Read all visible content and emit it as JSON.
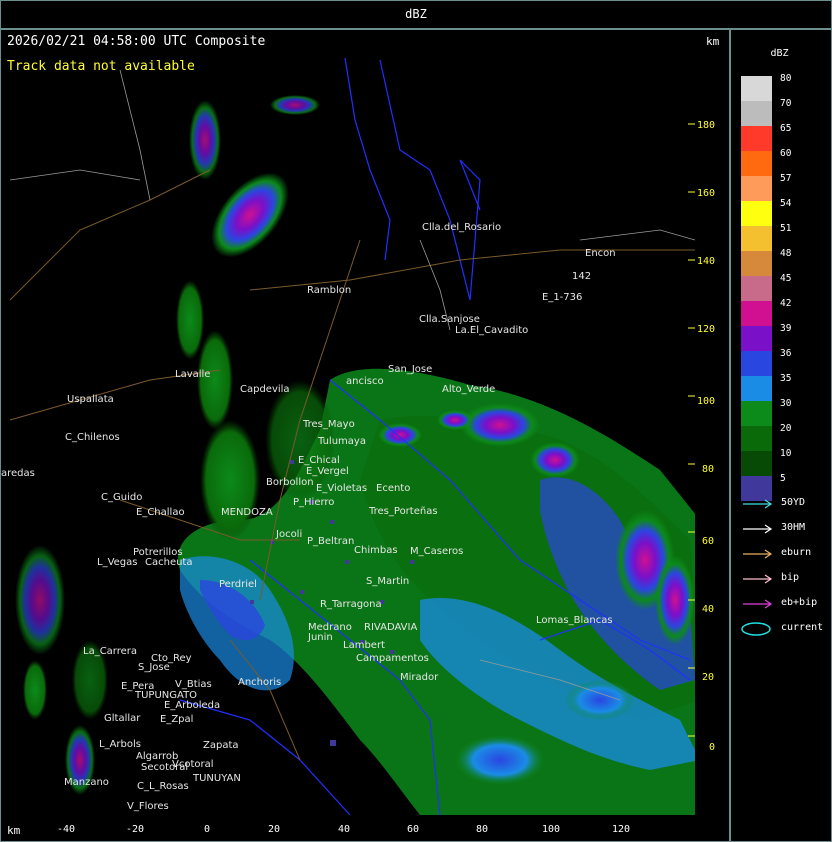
{
  "title": "dBZ",
  "header": "2026/02/21 04:58:00 UTC Composite",
  "track_message": "Track data not available",
  "km_top": "km",
  "km_bottom": "km",
  "y_ticks": [
    "180",
    "160",
    "140",
    "120",
    "100",
    "80",
    "60",
    "40",
    "20",
    "0"
  ],
  "x_ticks": [
    "-40",
    "-20",
    "0",
    "20",
    "40",
    "60",
    "80",
    "100",
    "120"
  ],
  "legend": {
    "title": "dBZ",
    "levels": [
      {
        "label": "80",
        "color": "#d8d8d8"
      },
      {
        "label": "70",
        "color": "#bcbcbc"
      },
      {
        "label": "65",
        "color": "#ff3a2a"
      },
      {
        "label": "60",
        "color": "#ff6a10"
      },
      {
        "label": "57",
        "color": "#ff9b5a"
      },
      {
        "label": "54",
        "color": "#ffff10"
      },
      {
        "label": "51",
        "color": "#f5c030"
      },
      {
        "label": "48",
        "color": "#d6893a"
      },
      {
        "label": "45",
        "color": "#c86a8a"
      },
      {
        "label": "42",
        "color": "#d01090"
      },
      {
        "label": "39",
        "color": "#7a10c8"
      },
      {
        "label": "36",
        "color": "#2a46e0"
      },
      {
        "label": "35",
        "color": "#1a8ce6"
      },
      {
        "label": "30",
        "color": "#0c8a1a"
      },
      {
        "label": "20",
        "color": "#0a6a0a"
      },
      {
        "label": "10",
        "color": "#064a06"
      },
      {
        "label": "5",
        "color": "#40389a"
      }
    ],
    "tracks": [
      {
        "label": "50YD",
        "color": "#40e0e0"
      },
      {
        "label": "30HM",
        "color": "#ffffff"
      },
      {
        "label": "eburn",
        "color": "#e8b060"
      },
      {
        "label": "bip",
        "color": "#ffc0d0"
      },
      {
        "label": "eb+bip",
        "color": "#e040e0"
      },
      {
        "label": "current",
        "color": "#20e0e0"
      }
    ]
  },
  "places": [
    "Clla.del_Rosario",
    "Encon",
    "142",
    "E_1-736",
    "Ramblon",
    "Clla.Sanjose",
    "La.El_Cavadito",
    "Uspallata",
    "C_Chilenos",
    "aredas",
    "San_Jose",
    "ancisco",
    "Tres_Mayo",
    "Tulumaya",
    "E_Chical",
    "E_Vergel",
    "Borbollon",
    "E_Violetas",
    "Ecento",
    "P_Hierro",
    "C_Guido",
    "E_Challao",
    "MENDOZA",
    "P_Beltran",
    "Chimbas",
    "M_Caseros",
    "Potrerillos",
    "Cacheuta",
    "L_Vegas",
    "Perdriel",
    "R_Tarragona",
    "Junin",
    "RIVADAVIA",
    "La_Carrera",
    "Cto_Rey",
    "S_Jose",
    "E_Pera",
    "TUPUNGATO",
    "V_Btias",
    "Anchoris",
    "E_Arboleda",
    "Gltallar",
    "E_Zpal",
    "L_Arbols",
    "Algarrob",
    "Zapata",
    "Vcotoral",
    "Secotoral",
    "TUNUYAN",
    "C_L_Rosas",
    "Manzano",
    "V_Flores",
    "Mirador",
    "Campamentos",
    "S_Martin",
    "Lomas_Blancas",
    "Tres_Porteñas",
    "Capdevila",
    "Lavalle",
    "Alto_Verde",
    "Jocoli",
    "Medrano",
    "Lambert"
  ]
}
